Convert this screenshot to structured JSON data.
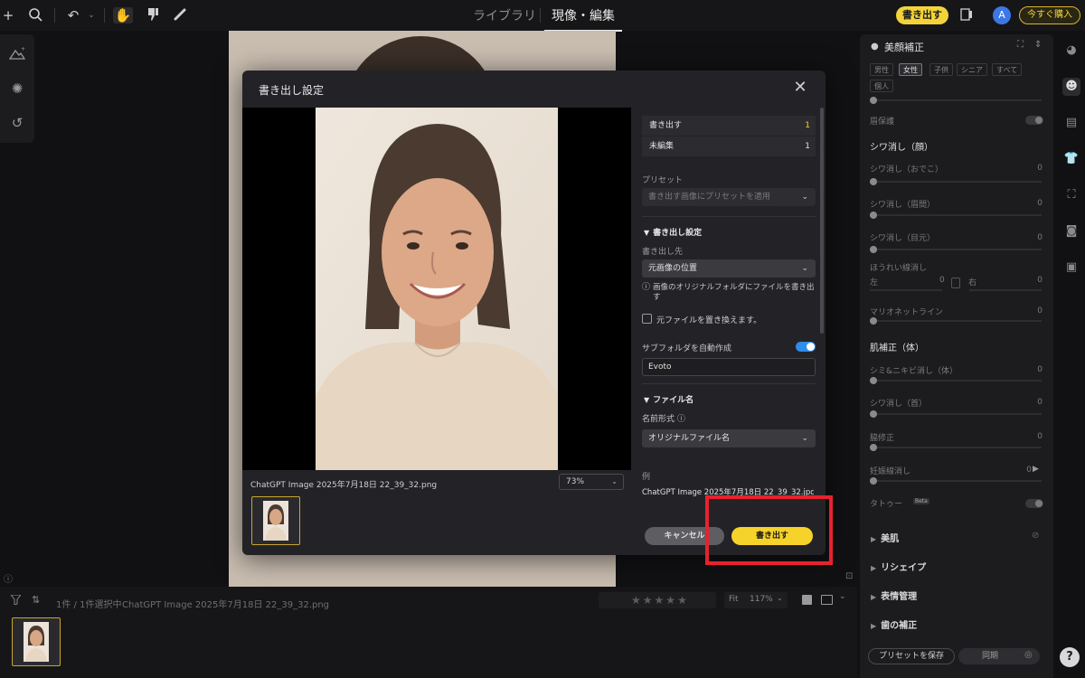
{
  "topbar": {
    "tabs": [
      {
        "label": "ライブラリ"
      },
      {
        "label": "現像・編集"
      }
    ],
    "export_label": "書き出す",
    "avatar_letter": "A",
    "buy_label": "今すぐ購入"
  },
  "bottombar": {
    "selection_text": "1件 / 1件選択中",
    "filename": "ChatGPT Image 2025年7月18日 22_39_32.png",
    "fit_label": "Fit",
    "zoom_label": "117%"
  },
  "rightpanel": {
    "title": "美顔補正",
    "chips": [
      "男性",
      "女性",
      "子供",
      "シニア",
      "すべて",
      "個人"
    ],
    "items": {
      "eyebrow_protect": "眉保護",
      "wrinkle_face_heading": "シワ消し（顔）",
      "forehead": {
        "label": "シワ消し（おでこ）",
        "value": "0"
      },
      "between_brows": {
        "label": "シワ消し（眉間）",
        "value": "0"
      },
      "eye_corner": {
        "label": "シワ消し（目元）",
        "value": "0"
      },
      "nasolabial": {
        "label": "ほうれい線消し",
        "left_label": "左",
        "left_value": "0",
        "right_label": "右",
        "right_value": "0"
      },
      "marionette": {
        "label": "マリオネットライン",
        "value": "0"
      },
      "skin_body_heading": "肌補正（体）",
      "blemish_body": {
        "label": "シミ&ニキビ消し（体）",
        "value": "0"
      },
      "wrinkle_neck": {
        "label": "シワ消し（首）",
        "value": "0"
      },
      "armpit": {
        "label": "脇修正",
        "value": "0"
      },
      "stretch": {
        "label": "妊娠線消し",
        "value": "0"
      },
      "tattoo": {
        "label": "タトゥー",
        "badge": "Beta"
      }
    },
    "sections": [
      "美肌",
      "リシェイプ",
      "表情管理",
      "歯の補正"
    ],
    "save_preset_label": "プリセットを保存",
    "sync_label": "同期"
  },
  "modal": {
    "title": "書き出し設定",
    "filename": "ChatGPT Image 2025年7月18日 22_39_32.png",
    "zoom": "73%",
    "summary": [
      {
        "label": "書き出す",
        "value": "1"
      },
      {
        "label": "未編集",
        "value": "1"
      }
    ],
    "preset_label": "プリセット",
    "preset_placeholder": "書き出す画像にプリセットを適用",
    "export_settings_heading": "書き出し設定",
    "destination_label": "書き出し先",
    "destination_value": "元画像の位置",
    "destination_note": "画像のオリジナルフォルダにファイルを書き出す",
    "overwrite_label": "元ファイルを置き換えます。",
    "subfolder_label": "サブフォルダを自動作成",
    "subfolder_value": "Evoto",
    "filename_heading": "ファイル名",
    "name_format_label": "名前形式",
    "name_format_value": "オリジナルファイル名",
    "example_label": "例",
    "example_value": "ChatGPT Image 2025年7月18日 22_39_32.jpg",
    "cancel_label": "キャンセル",
    "export_label": "書き出す"
  },
  "colors": {
    "accent_yellow": "#f6d32a",
    "toggle_blue": "#2f8ce8",
    "highlight_red": "#e8212e"
  }
}
